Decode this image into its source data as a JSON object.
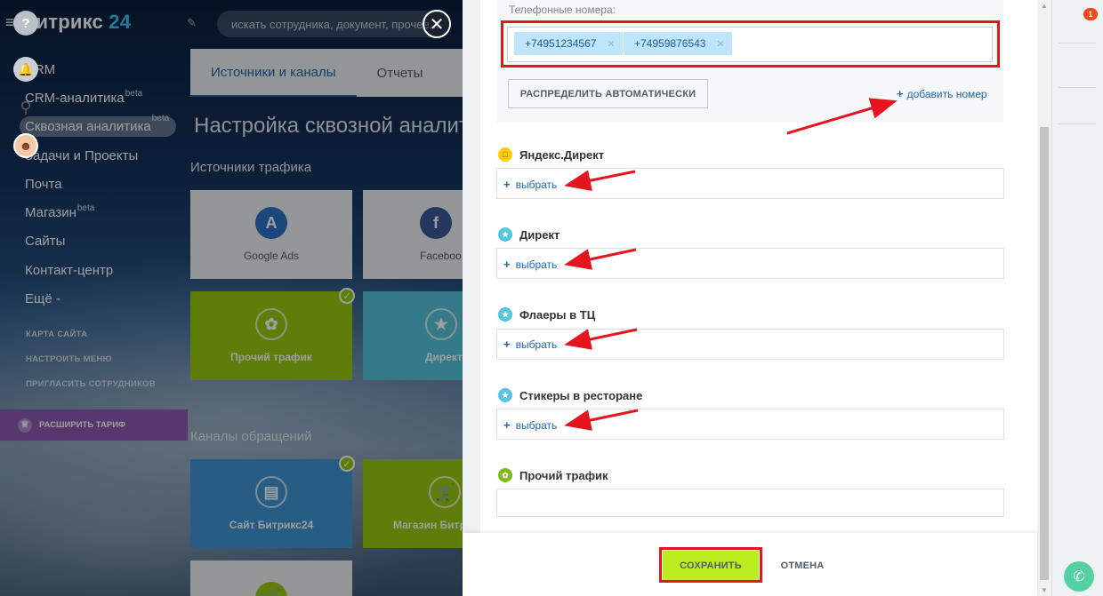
{
  "app": {
    "logo_main": "Битрикс",
    "logo_num": "24",
    "search_placeholder": "искать сотрудника, документ, прочее..."
  },
  "left_menu": {
    "items": [
      {
        "label": "CRM",
        "beta": ""
      },
      {
        "label": "CRM-аналитика",
        "beta": "beta"
      },
      {
        "label": "Сквозная аналитика",
        "beta": "beta"
      },
      {
        "label": "Задачи и Проекты",
        "beta": ""
      },
      {
        "label": "Почта",
        "beta": ""
      },
      {
        "label": "Магазин",
        "beta": "beta"
      },
      {
        "label": "Сайты",
        "beta": ""
      },
      {
        "label": "Контакт-центр",
        "beta": ""
      },
      {
        "label": "Ещё -",
        "beta": ""
      }
    ],
    "sitemap": "КАРТА САЙТА",
    "configure": "НАСТРОИТЬ МЕНЮ",
    "invite": "ПРИГЛАСИТЬ СОТРУДНИКОВ",
    "upgrade": "РАСШИРИТЬ ТАРИФ"
  },
  "background_page": {
    "tabs": [
      "Источники и каналы",
      "Отчеты"
    ],
    "title": "Настройка сквозной аналит",
    "traffic_sources_title": "Источники трафика",
    "channels_title": "Каналы обращений",
    "tiles": {
      "google_ads": "Google Ads",
      "facebook": "Faceboo",
      "other_traffic": "Прочий трафик",
      "direct": "Директ",
      "site_b24": "Сайт Битрикс24",
      "shop_b24": "Магазин Битр"
    }
  },
  "panel": {
    "phones_label": "Телефонные номера:",
    "phones": [
      "+74951234567",
      "+74959876543"
    ],
    "auto_distribute": "РАСПРЕДЕЛИТЬ АВТОМАТИЧЕСКИ",
    "add_number": "добавить номер",
    "sources": [
      {
        "title": "Яндекс.Директ",
        "choose": "выбрать"
      },
      {
        "title": "Директ",
        "choose": "выбрать"
      },
      {
        "title": "Флаеры в ТЦ",
        "choose": "выбрать"
      },
      {
        "title": "Стикеры в ресторане",
        "choose": "выбрать"
      },
      {
        "title": "Прочий трафик",
        "choose": ""
      }
    ],
    "save": "СОХРАНИТЬ",
    "cancel": "ОТМЕНА"
  },
  "right_sidebar": {
    "help_badge": "1"
  },
  "colors": {
    "accent_blue": "#2067b0",
    "save_green": "#bbed21",
    "annotation_red": "#e5141e",
    "tile_green": "#9acb0f",
    "tile_teal": "#54c6dd",
    "tile_blue": "#3f95d7"
  }
}
